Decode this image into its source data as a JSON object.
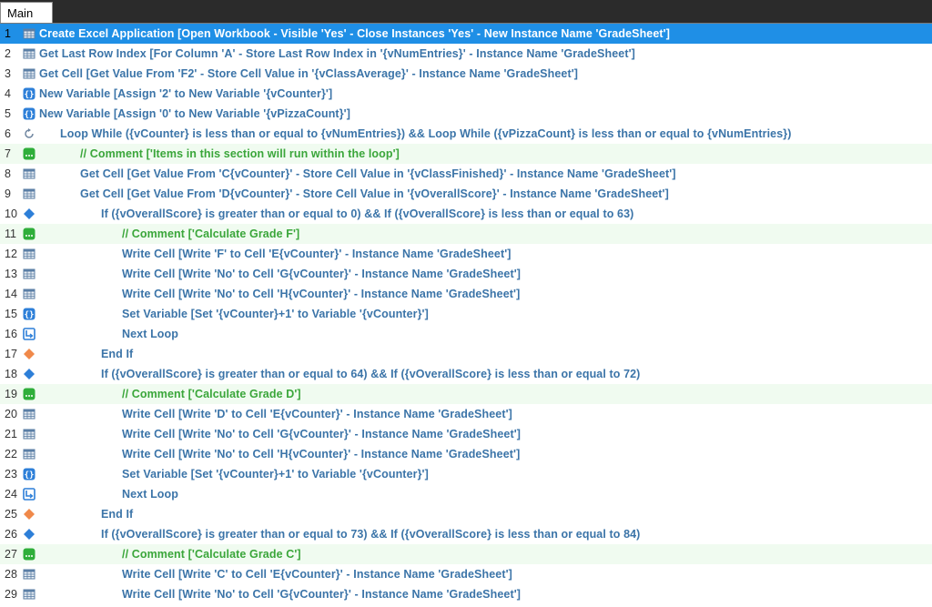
{
  "tab": {
    "label": "Main"
  },
  "rows": [
    {
      "num": "1",
      "icon": "excel",
      "indent": 0,
      "text": "Create Excel Application [Open Workbook - Visible 'Yes' - Close Instances 'Yes' - New Instance Name 'GradeSheet']",
      "type": "selected"
    },
    {
      "num": "2",
      "icon": "excel",
      "indent": 0,
      "text": "Get Last Row Index [For Column 'A' - Store Last Row Index in '{vNumEntries}' - Instance Name 'GradeSheet']",
      "type": "normal"
    },
    {
      "num": "3",
      "icon": "excel",
      "indent": 0,
      "text": "Get Cell [Get Value From 'F2' - Store Cell Value in '{vClassAverage}' - Instance Name 'GradeSheet']",
      "type": "normal"
    },
    {
      "num": "4",
      "icon": "variable",
      "indent": 0,
      "text": "New Variable [Assign '2' to New Variable '{vCounter}']",
      "type": "normal"
    },
    {
      "num": "5",
      "icon": "variable",
      "indent": 0,
      "text": "New Variable [Assign '0' to New Variable '{vPizzaCount}']",
      "type": "normal"
    },
    {
      "num": "6",
      "icon": "loop",
      "indent": 1,
      "text": "Loop While ({vCounter} is less than or equal to {vNumEntries}) && Loop While ({vPizzaCount} is less than or equal to {vNumEntries})",
      "type": "normal"
    },
    {
      "num": "7",
      "icon": "comment",
      "indent": 2,
      "text": "// Comment ['Items in this section will run within the loop']",
      "type": "comment"
    },
    {
      "num": "8",
      "icon": "excel",
      "indent": 2,
      "text": "Get Cell [Get Value From 'C{vCounter}' - Store Cell Value in '{vClassFinished}' - Instance Name 'GradeSheet']",
      "type": "normal"
    },
    {
      "num": "9",
      "icon": "excel",
      "indent": 2,
      "text": "Get Cell [Get Value From 'D{vCounter}' - Store Cell Value in '{vOverallScore}' - Instance Name 'GradeSheet']",
      "type": "normal"
    },
    {
      "num": "10",
      "icon": "if",
      "indent": 3,
      "text": "If ({vOverallScore} is greater than or equal to 0) && If ({vOverallScore} is less than or equal to 63)",
      "type": "normal"
    },
    {
      "num": "11",
      "icon": "comment",
      "indent": 4,
      "text": "// Comment ['Calculate Grade F']",
      "type": "comment"
    },
    {
      "num": "12",
      "icon": "excel",
      "indent": 4,
      "text": "Write Cell [Write 'F' to Cell 'E{vCounter}' - Instance Name 'GradeSheet']",
      "type": "normal"
    },
    {
      "num": "13",
      "icon": "excel",
      "indent": 4,
      "text": "Write Cell [Write 'No' to Cell 'G{vCounter}' - Instance Name 'GradeSheet']",
      "type": "normal"
    },
    {
      "num": "14",
      "icon": "excel",
      "indent": 4,
      "text": "Write Cell [Write 'No' to Cell 'H{vCounter}' - Instance Name 'GradeSheet']",
      "type": "normal"
    },
    {
      "num": "15",
      "icon": "variable",
      "indent": 4,
      "text": "Set Variable [Set '{vCounter}+1' to Variable '{vCounter}']",
      "type": "normal"
    },
    {
      "num": "16",
      "icon": "nextloop",
      "indent": 4,
      "text": "Next Loop",
      "type": "normal"
    },
    {
      "num": "17",
      "icon": "endif",
      "indent": 3,
      "text": "End If",
      "type": "normal"
    },
    {
      "num": "18",
      "icon": "if",
      "indent": 3,
      "text": "If ({vOverallScore} is greater than or equal to 64) && If ({vOverallScore} is less than or equal to 72)",
      "type": "normal"
    },
    {
      "num": "19",
      "icon": "comment",
      "indent": 4,
      "text": "// Comment ['Calculate Grade D']",
      "type": "comment"
    },
    {
      "num": "20",
      "icon": "excel",
      "indent": 4,
      "text": "Write Cell [Write 'D' to Cell 'E{vCounter}' - Instance Name 'GradeSheet']",
      "type": "normal"
    },
    {
      "num": "21",
      "icon": "excel",
      "indent": 4,
      "text": "Write Cell [Write 'No' to Cell 'G{vCounter}' - Instance Name 'GradeSheet']",
      "type": "normal"
    },
    {
      "num": "22",
      "icon": "excel",
      "indent": 4,
      "text": "Write Cell [Write 'No' to Cell 'H{vCounter}' - Instance Name 'GradeSheet']",
      "type": "normal"
    },
    {
      "num": "23",
      "icon": "variable",
      "indent": 4,
      "text": "Set Variable [Set '{vCounter}+1' to Variable '{vCounter}']",
      "type": "normal"
    },
    {
      "num": "24",
      "icon": "nextloop",
      "indent": 4,
      "text": "Next Loop",
      "type": "normal"
    },
    {
      "num": "25",
      "icon": "endif",
      "indent": 3,
      "text": "End If",
      "type": "normal"
    },
    {
      "num": "26",
      "icon": "if",
      "indent": 3,
      "text": "If ({vOverallScore} is greater than or equal to 73) && If ({vOverallScore} is less than or equal to 84)",
      "type": "normal"
    },
    {
      "num": "27",
      "icon": "comment",
      "indent": 4,
      "text": "// Comment ['Calculate Grade C']",
      "type": "comment"
    },
    {
      "num": "28",
      "icon": "excel",
      "indent": 4,
      "text": "Write Cell [Write 'C' to Cell 'E{vCounter}' - Instance Name 'GradeSheet']",
      "type": "normal"
    },
    {
      "num": "29",
      "icon": "excel",
      "indent": 4,
      "text": "Write Cell [Write 'No' to Cell 'G{vCounter}' - Instance Name 'GradeSheet']",
      "type": "normal"
    }
  ]
}
